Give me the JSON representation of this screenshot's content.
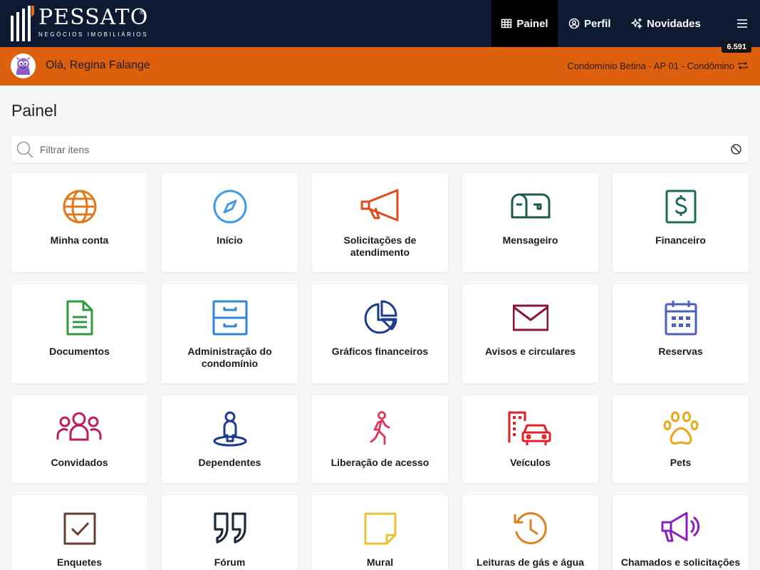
{
  "brand": {
    "name": "PESSATO",
    "tagline": "NEGÓCIOS IMOBILIÁRIOS",
    "registered": "®"
  },
  "nav": {
    "painel": "Painel",
    "perfil": "Perfil",
    "novidades": "Novidades"
  },
  "user_bar": {
    "greeting": "Olá, Regina Falange",
    "condo": "Condomínio Betina - AP 01 - Condômino",
    "badge": "6.591"
  },
  "page": {
    "title": "Painel"
  },
  "filter": {
    "placeholder": "Filtrar itens",
    "value": ""
  },
  "tiles": [
    {
      "label": "Minha conta",
      "icon": "globe-icon",
      "color": "#e07a1c"
    },
    {
      "label": "Início",
      "icon": "compass-icon",
      "color": "#3d9be9"
    },
    {
      "label": "Solicitações de atendimento",
      "icon": "megaphone-icon",
      "color": "#e2491a"
    },
    {
      "label": "Mensageiro",
      "icon": "mailbox-icon",
      "color": "#1d5a4e"
    },
    {
      "label": "Financeiro",
      "icon": "dollar-icon",
      "color": "#1d6a5c"
    },
    {
      "label": "Documentos",
      "icon": "document-icon",
      "color": "#2e9a3e"
    },
    {
      "label": "Administração do condomínio",
      "icon": "file-cabinet-icon",
      "color": "#2f86d9"
    },
    {
      "label": "Gráficos financeiros",
      "icon": "pie-chart-icon",
      "color": "#1c3b8c"
    },
    {
      "label": "Avisos e circulares",
      "icon": "envelope-icon",
      "color": "#8a1538"
    },
    {
      "label": "Reservas",
      "icon": "calendar-icon",
      "color": "#4a5fc1"
    },
    {
      "label": "Convidados",
      "icon": "group-icon",
      "color": "#c21b5a"
    },
    {
      "label": "Dependentes",
      "icon": "person-pin-icon",
      "color": "#1c3b8c"
    },
    {
      "label": "Liberação de acesso",
      "icon": "walking-icon",
      "color": "#e0345a"
    },
    {
      "label": "Veículos",
      "icon": "car-building-icon",
      "color": "#e21f26"
    },
    {
      "label": "Pets",
      "icon": "paw-icon",
      "color": "#f0a41a"
    },
    {
      "label": "Enquetes",
      "icon": "checkbox-icon",
      "color": "#6a3e2e"
    },
    {
      "label": "Fórum",
      "icon": "quote-icon",
      "color": "#1e2a3a"
    },
    {
      "label": "Mural",
      "icon": "sticky-note-icon",
      "color": "#e7c33a"
    },
    {
      "label": "Leituras de gás e água",
      "icon": "history-icon",
      "color": "#e0801c"
    },
    {
      "label": "Chamados e solicitações",
      "icon": "megaphone-icon",
      "color": "#8a1fc0"
    }
  ]
}
